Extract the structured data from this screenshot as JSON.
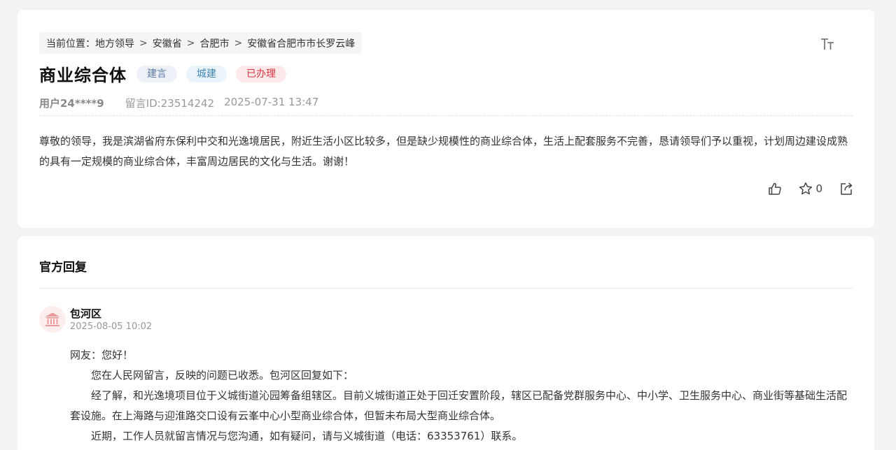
{
  "breadcrumb": {
    "prefix": "当前位置：",
    "items": [
      "地方领导",
      "安徽省",
      "合肥市",
      "安徽省合肥市市长罗云峰"
    ],
    "separator": ">"
  },
  "font_size_toggle": {
    "icon": "font-size-icon",
    "label": "TT"
  },
  "message": {
    "title": "商业综合体",
    "tags": [
      "建言",
      "城建",
      "已办理"
    ],
    "user": "用户24****9",
    "message_id": "留言ID:23514242",
    "time": "2025-07-31 13:47",
    "content": "尊敬的领导，我是滨湖省府东保利中交和光逸境居民，附近生活小区比较多，但是缺少规模性的商业综合体，生活上配套服务不完善，恳请领导们予以重视，计划周边建设成熟的具有一定规模的商业综合体，丰富周边居民的文化与生活。谢谢！"
  },
  "actions": {
    "like_icon": "thumbs-up-icon",
    "favorite_icon": "star-icon",
    "favorite_count": "0",
    "share_icon": "share-icon"
  },
  "reply": {
    "heading": "官方回复",
    "org_icon": "government-building-icon",
    "org_name": "包河区",
    "time": "2025-08-05 10:02",
    "greeting": "网友：您好！",
    "paragraphs": [
      "您在人民网留言，反映的问题已收悉。包河区回复如下：",
      "经了解，和光逸境项目位于义城街道沁园筹备组辖区。目前义城街道正处于回迁安置阶段，辖区已配备党群服务中心、中小学、卫生服务中心、商业街等基础生活配套设施。在上海路与迎淮路交口设有云峯中心小型商业综合体，但暂未布局大型商业综合体。",
      "近期，工作人员就留言情况与您沟通，如有疑问，请与义城街道（电话：63353761）联系。"
    ]
  }
}
